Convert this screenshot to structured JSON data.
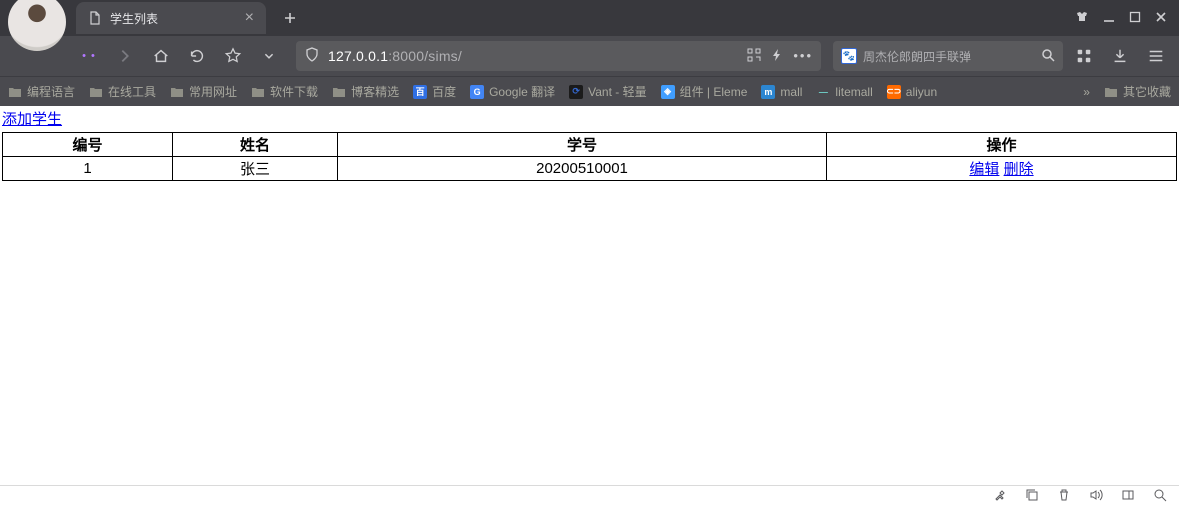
{
  "browser": {
    "tab_title": "学生列表",
    "url_prefix": "127.0.0.1",
    "url_port_path": ":8000/sims/",
    "search_placeholder": "周杰伦郎朗四手联弹",
    "bookmarks": [
      {
        "type": "folder",
        "label": "编程语言"
      },
      {
        "type": "folder",
        "label": "在线工具"
      },
      {
        "type": "folder",
        "label": "常用网址"
      },
      {
        "type": "folder",
        "label": "软件下载"
      },
      {
        "type": "folder",
        "label": "博客精选"
      },
      {
        "type": "site",
        "label": "百度",
        "iconBg": "#2f6fe4",
        "iconFg": "#fff",
        "iconText": "百"
      },
      {
        "type": "site",
        "label": "Google 翻译",
        "iconBg": "#4285f4",
        "iconFg": "#fff",
        "iconText": "G"
      },
      {
        "type": "site",
        "label": "Vant - 轻量",
        "iconBg": "#1b1b1b",
        "iconFg": "#36c",
        "iconText": "⟳"
      },
      {
        "type": "site",
        "label": "组件 | Eleme",
        "iconBg": "#409eff",
        "iconFg": "#fff",
        "iconText": "◈"
      },
      {
        "type": "site",
        "label": "mall",
        "iconBg": "#2c86d1",
        "iconFg": "#fff",
        "iconText": "m"
      },
      {
        "type": "site",
        "label": "litemall",
        "iconBg": "",
        "iconFg": "#6fd0c8",
        "iconText": "—"
      },
      {
        "type": "site",
        "label": "aliyun",
        "iconBg": "#ff6a00",
        "iconFg": "#fff",
        "iconText": "⊂⊃"
      }
    ],
    "bm_more": "»",
    "bm_other": "其它收藏"
  },
  "page": {
    "add_link": "添加学生",
    "headers": [
      "编号",
      "姓名",
      "学号",
      "操作"
    ],
    "rows": [
      {
        "id": "1",
        "name": "张三",
        "sno": "20200510001",
        "edit": "编辑",
        "del": "删除"
      }
    ]
  }
}
